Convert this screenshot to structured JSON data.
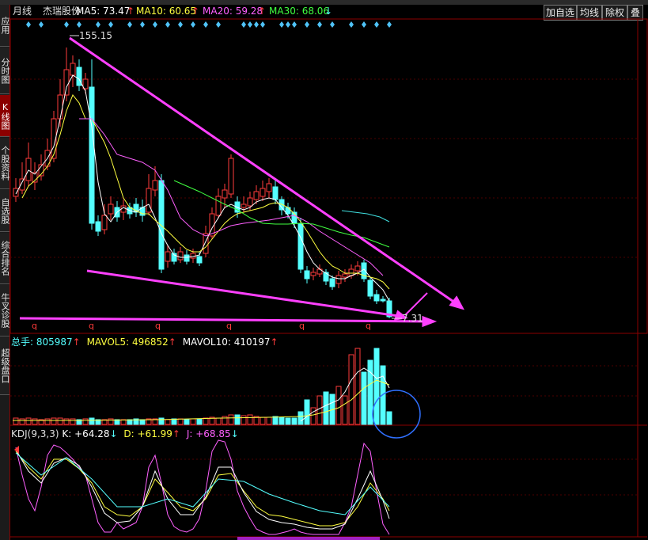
{
  "left_tabs": [
    "应用",
    "分时图",
    "K线图",
    "个股资料",
    "自选股",
    "综合排名",
    "牛叉诊股",
    "超级盘口"
  ],
  "header": {
    "period": "月线",
    "stock_name": "杰瑞股份",
    "ma5": "MA5: 73.47",
    "ma10": "MA10: 60.65",
    "ma20": "MA20: 59.28",
    "ma30": "MA30: 68.06",
    "arrow_up": "↑",
    "arrow_down": "↓"
  },
  "buttons": {
    "add_watch": "加自选",
    "ma_line": "均线",
    "adjust": "除权",
    "overlay": "叠"
  },
  "price_panel": {
    "high_label": "155.15",
    "low_label": "7.31",
    "q_marker": "q"
  },
  "volume_panel": {
    "total": "总手: 805987",
    "mavol5": "MAVOL5: 496852",
    "mavol10": "MAVOL10: 410197"
  },
  "kdj_panel": {
    "name": "KDJ(9,3,3)",
    "k": "K: +64.28",
    "d": "D: +61.99",
    "j": "J: +68.85"
  },
  "colors": {
    "up": "#ff3b3b",
    "down": "#54ffff",
    "ma5": "#ffffff",
    "ma10": "#ffff40",
    "ma20": "#ff60ff",
    "ma30": "#40ff40",
    "annotation": "#ff40ff",
    "circle": "#3070ff"
  }
}
